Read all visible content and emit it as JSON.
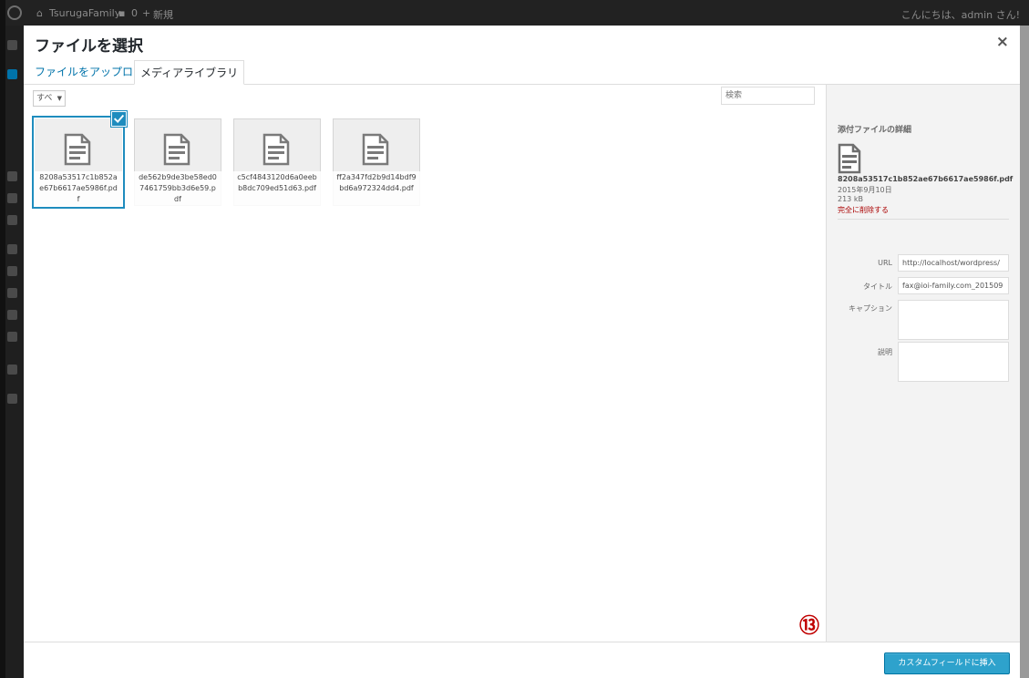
{
  "admin_bar": {
    "site_name": "TsurugaFamily",
    "comment_count": "0",
    "new_label": "新規",
    "greeting": "こんにちは、admin さん!"
  },
  "modal": {
    "title": "ファイルを選択",
    "close_icon": "×",
    "tabs": [
      {
        "label": "ファイルをアップロード",
        "active": false
      },
      {
        "label": "メディアライブラリ",
        "active": true
      }
    ],
    "filter_select": "すべ",
    "search_placeholder": "検索",
    "attachments": [
      {
        "filename": "8208a53517c1b852ae67b6617ae5986f.pdf",
        "selected": true
      },
      {
        "filename": "de562b9de3be58ed07461759bb3d6e59.pdf",
        "selected": false
      },
      {
        "filename": "c5cf4843120d6a0eebb8dc709ed51d63.pdf",
        "selected": false
      },
      {
        "filename": "ff2a347fd2b9d14bdf9bd6a972324dd4.pdf",
        "selected": false
      }
    ]
  },
  "details": {
    "heading": "添付ファイルの詳細",
    "filename": "8208a53517c1b852ae67b6617ae5986f.pdf",
    "date": "2015年9月10日",
    "size": "213 kB",
    "delete_link": "完全に削除する",
    "url_label": "URL",
    "url_value": "http://localhost/wordpress/",
    "title_label": "タイトル",
    "title_value": "fax@ioi-family.com_201509",
    "caption_label": "キャプション",
    "description_label": "説明"
  },
  "toolbar": {
    "insert_button": "カスタムフィールドに挿入"
  },
  "annotation": "⑬",
  "colors": {
    "accent": "#1e8cbe",
    "button": "#2ea2cc",
    "delete": "#aa0000",
    "annotation": "#c00000"
  },
  "icons": [
    "wordpress-logo-icon",
    "home-icon",
    "comment-icon",
    "plus-icon",
    "document-icon",
    "check-icon",
    "close-icon"
  ]
}
